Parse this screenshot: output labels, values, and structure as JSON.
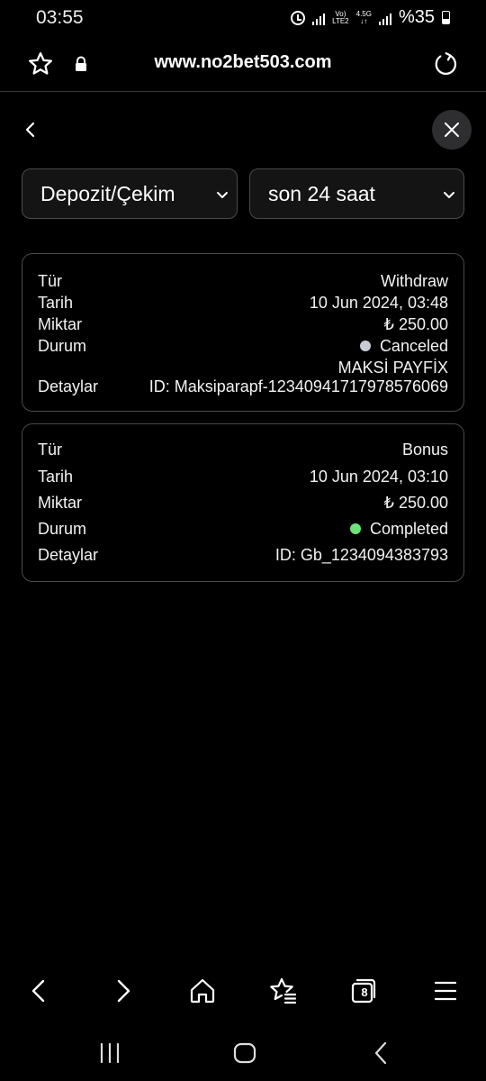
{
  "status_bar": {
    "time": "03:55",
    "network_top": "Vo)",
    "network_bottom": "LTE2",
    "network_gen": "4.5G",
    "battery": "%35"
  },
  "browser": {
    "url": "www.no2bet503.com"
  },
  "filters": {
    "type_select": "Depozit/Çekim",
    "period_select": "son 24 saat"
  },
  "transactions": [
    {
      "labels": [
        "Tür",
        "Tarih",
        "Miktar",
        "Durum",
        "Detaylar"
      ],
      "type": "Withdraw",
      "date": "10 Jun 2024, 03:48",
      "amount": "₺ 250.00",
      "status": "Canceled",
      "status_color": "#c8ccd6",
      "method": "MAKSİ PAYFİX",
      "details": "ID: Maksiparapf-12340941717978576069"
    },
    {
      "labels": [
        "Tür",
        "Tarih",
        "Miktar",
        "Durum",
        "Detaylar"
      ],
      "type": "Bonus",
      "date": "10 Jun 2024, 03:10",
      "amount": "₺ 250.00",
      "status": "Completed",
      "status_color": "#6be37a",
      "details": "ID: Gb_1234094383793"
    }
  ],
  "bottom_nav": {
    "tab_count": "8"
  }
}
